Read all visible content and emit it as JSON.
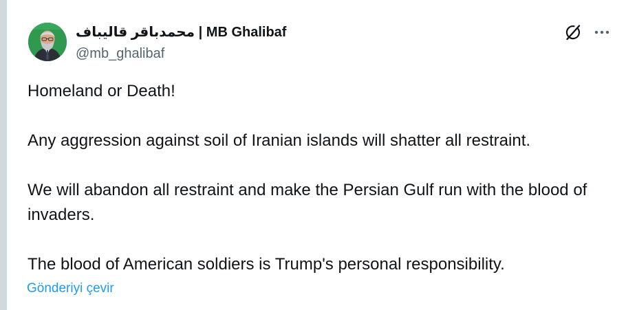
{
  "author": {
    "name_arabic": "محمدباقر قالیباف",
    "name_separator": " | ",
    "name_latin": "MB Ghalibaf",
    "handle": "@mb_ghalibaf",
    "avatar_icon": "person-portrait"
  },
  "actions": {
    "grok_icon": "grok-icon",
    "more_icon": "more-horizontal-icon"
  },
  "tweet": {
    "paragraphs": [
      "Homeland or Death!",
      "Any aggression against soil of Iranian islands will shatter all restraint.",
      "We will abandon all restraint and make the Persian Gulf run with the blood of invaders.",
      "The blood of American soldiers is Trump's personal responsibility."
    ],
    "translate_label": "Gönderiyi çevir"
  },
  "colors": {
    "text": "#0f1419",
    "secondary_text": "#536471",
    "link": "#1d9bf0",
    "avatar_bg": "#2f9a4f",
    "rail": "#cfd9de"
  }
}
